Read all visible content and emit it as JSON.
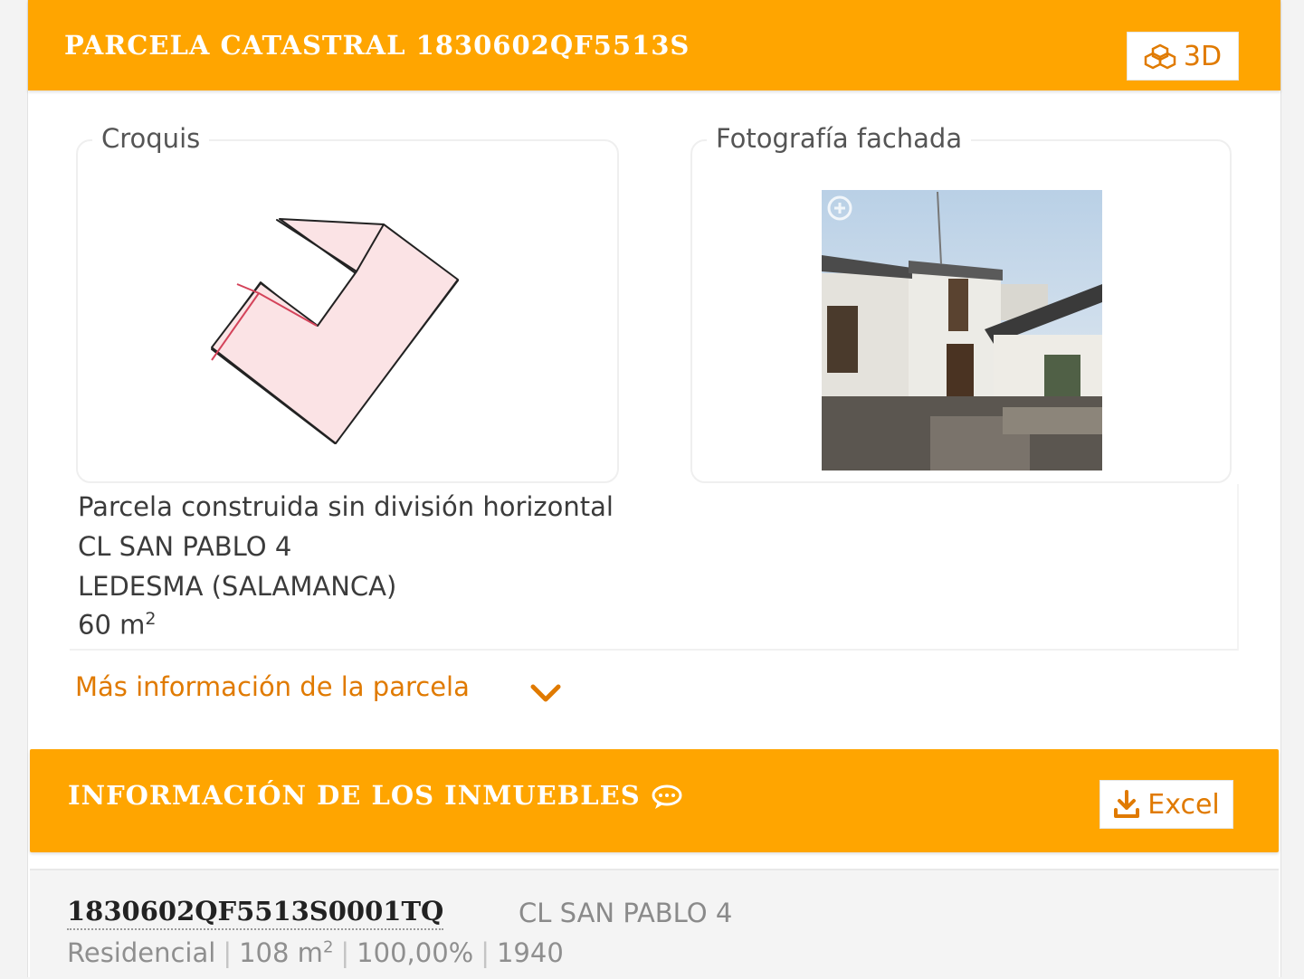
{
  "parcela": {
    "title": "PARCELA CATASTRAL 1830602QF5513S",
    "btn_3d": "3D",
    "croquis_legend": "Croquis",
    "foto_legend": "Fotografía fachada",
    "tipo": "Parcela construida sin división horizontal",
    "direccion": "CL SAN PABLO 4",
    "municipio": "LEDESMA (SALAMANCA)",
    "superficie": "60 m",
    "superficie_exp": "2",
    "mas_info": "Más información de la parcela"
  },
  "inmuebles": {
    "title": "INFORMACIÓN DE LOS INMUEBLES",
    "btn_excel": "Excel",
    "items": [
      {
        "referencia": "1830602QF5513S0001TQ",
        "direccion": "CL SAN PABLO 4",
        "uso": "Residencial",
        "superficie": "108 m",
        "superficie_exp": "2",
        "participacion": "100,00%",
        "anio": "1940"
      }
    ]
  },
  "colors": {
    "accent": "#ffa500",
    "link": "#e07a00",
    "sketch_fill": "#fbe3e5"
  },
  "icons": [
    "cubes-icon",
    "download-icon",
    "comment-icon",
    "chevron-down-icon",
    "zoom-plus-icon"
  ]
}
